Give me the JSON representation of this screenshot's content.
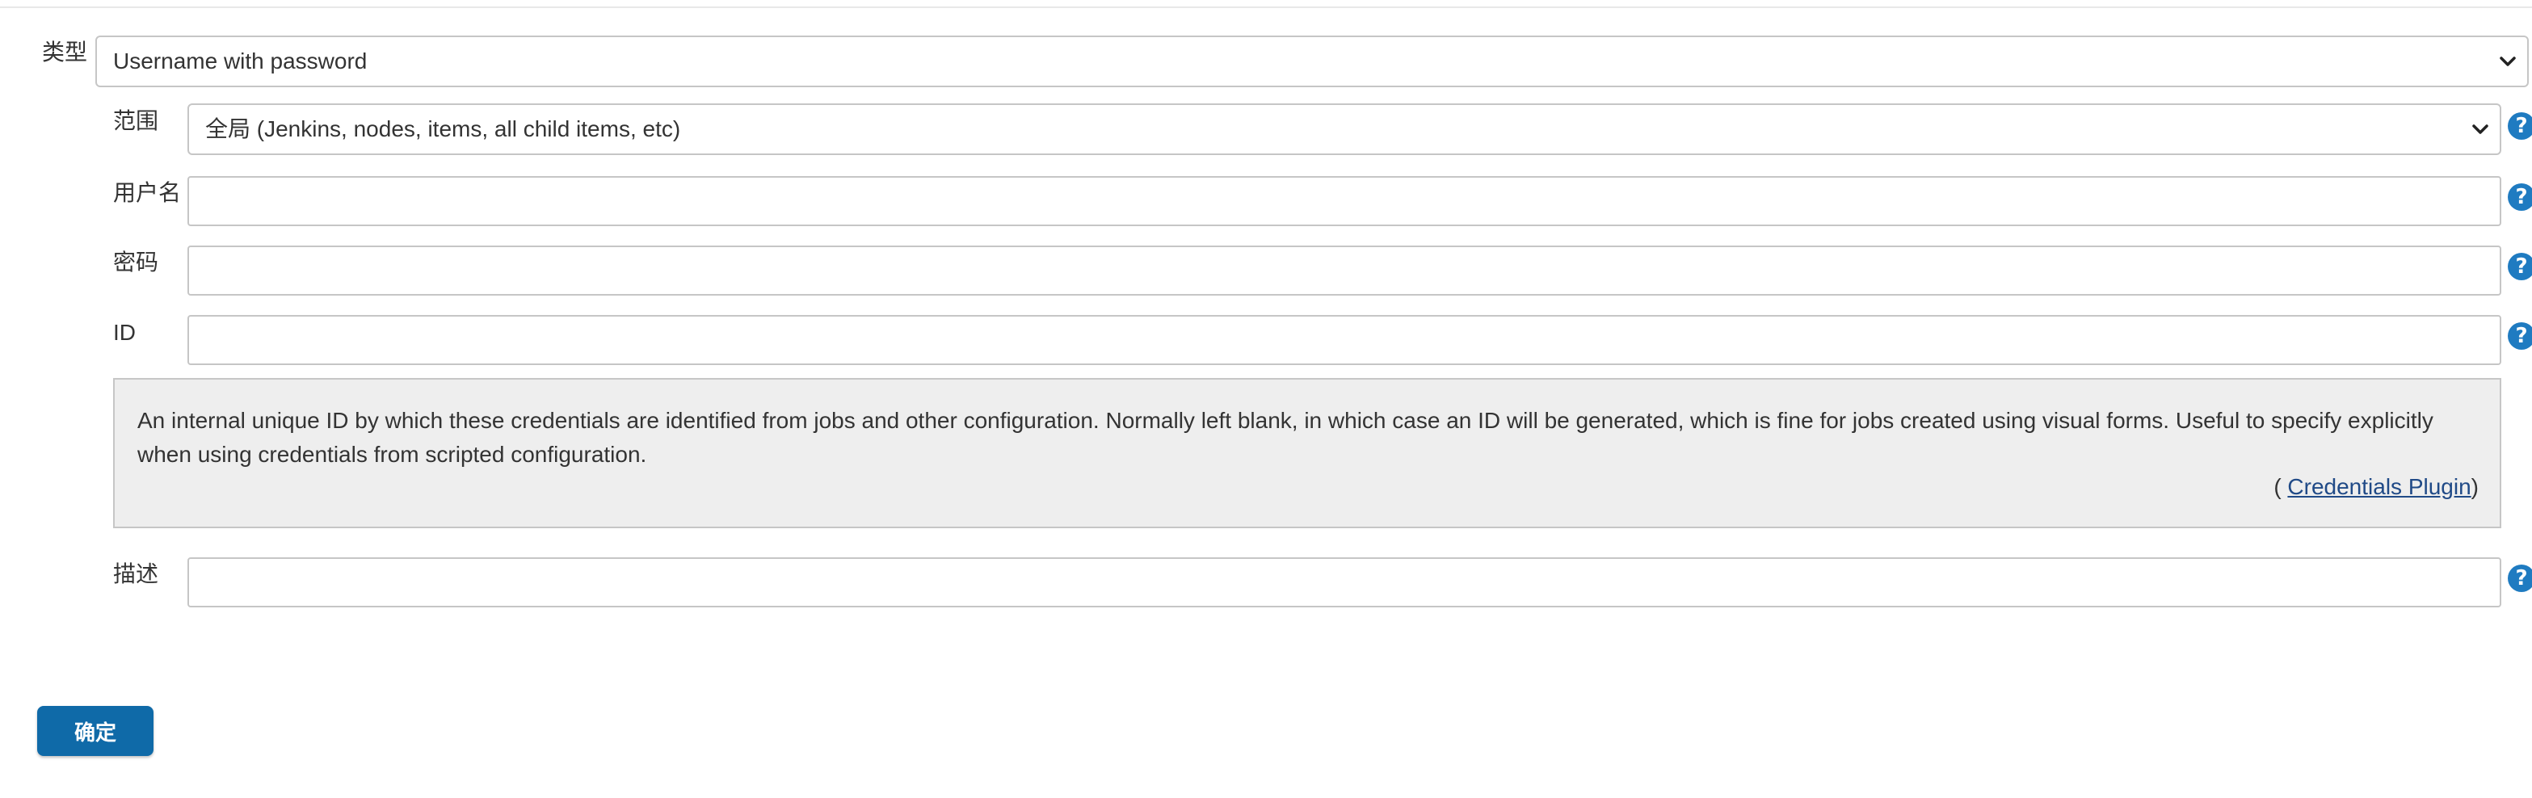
{
  "form": {
    "kind": {
      "label": "类型",
      "value": "Username with password"
    },
    "scope": {
      "label": "范围",
      "value": "全局 (Jenkins, nodes, items, all child items, etc)"
    },
    "username": {
      "label": "用户名",
      "value": ""
    },
    "password": {
      "label": "密码",
      "value": ""
    },
    "id": {
      "label": "ID",
      "value": ""
    },
    "description": {
      "label": "描述",
      "value": ""
    },
    "help_icon_glyph": "?"
  },
  "id_help": {
    "text": "An internal unique ID by which these credentials are identified from jobs and other configuration. Normally left blank, in which case an ID will be generated, which is fine for jobs created using visual forms. Useful to specify explicitly when using credentials from scripted configuration.",
    "source_prefix": "( ",
    "source_link": "Credentials Plugin",
    "source_suffix": ")"
  },
  "actions": {
    "ok_label": "确定"
  },
  "colors": {
    "help_icon": "#1f7bc1",
    "ok_button": "#0f6aa8",
    "link": "#204a87",
    "help_box_bg": "#eeeeee",
    "border": "#c6c6c6"
  },
  "icons": {
    "help": "help-icon",
    "dropdown": "chevron-down-icon"
  }
}
